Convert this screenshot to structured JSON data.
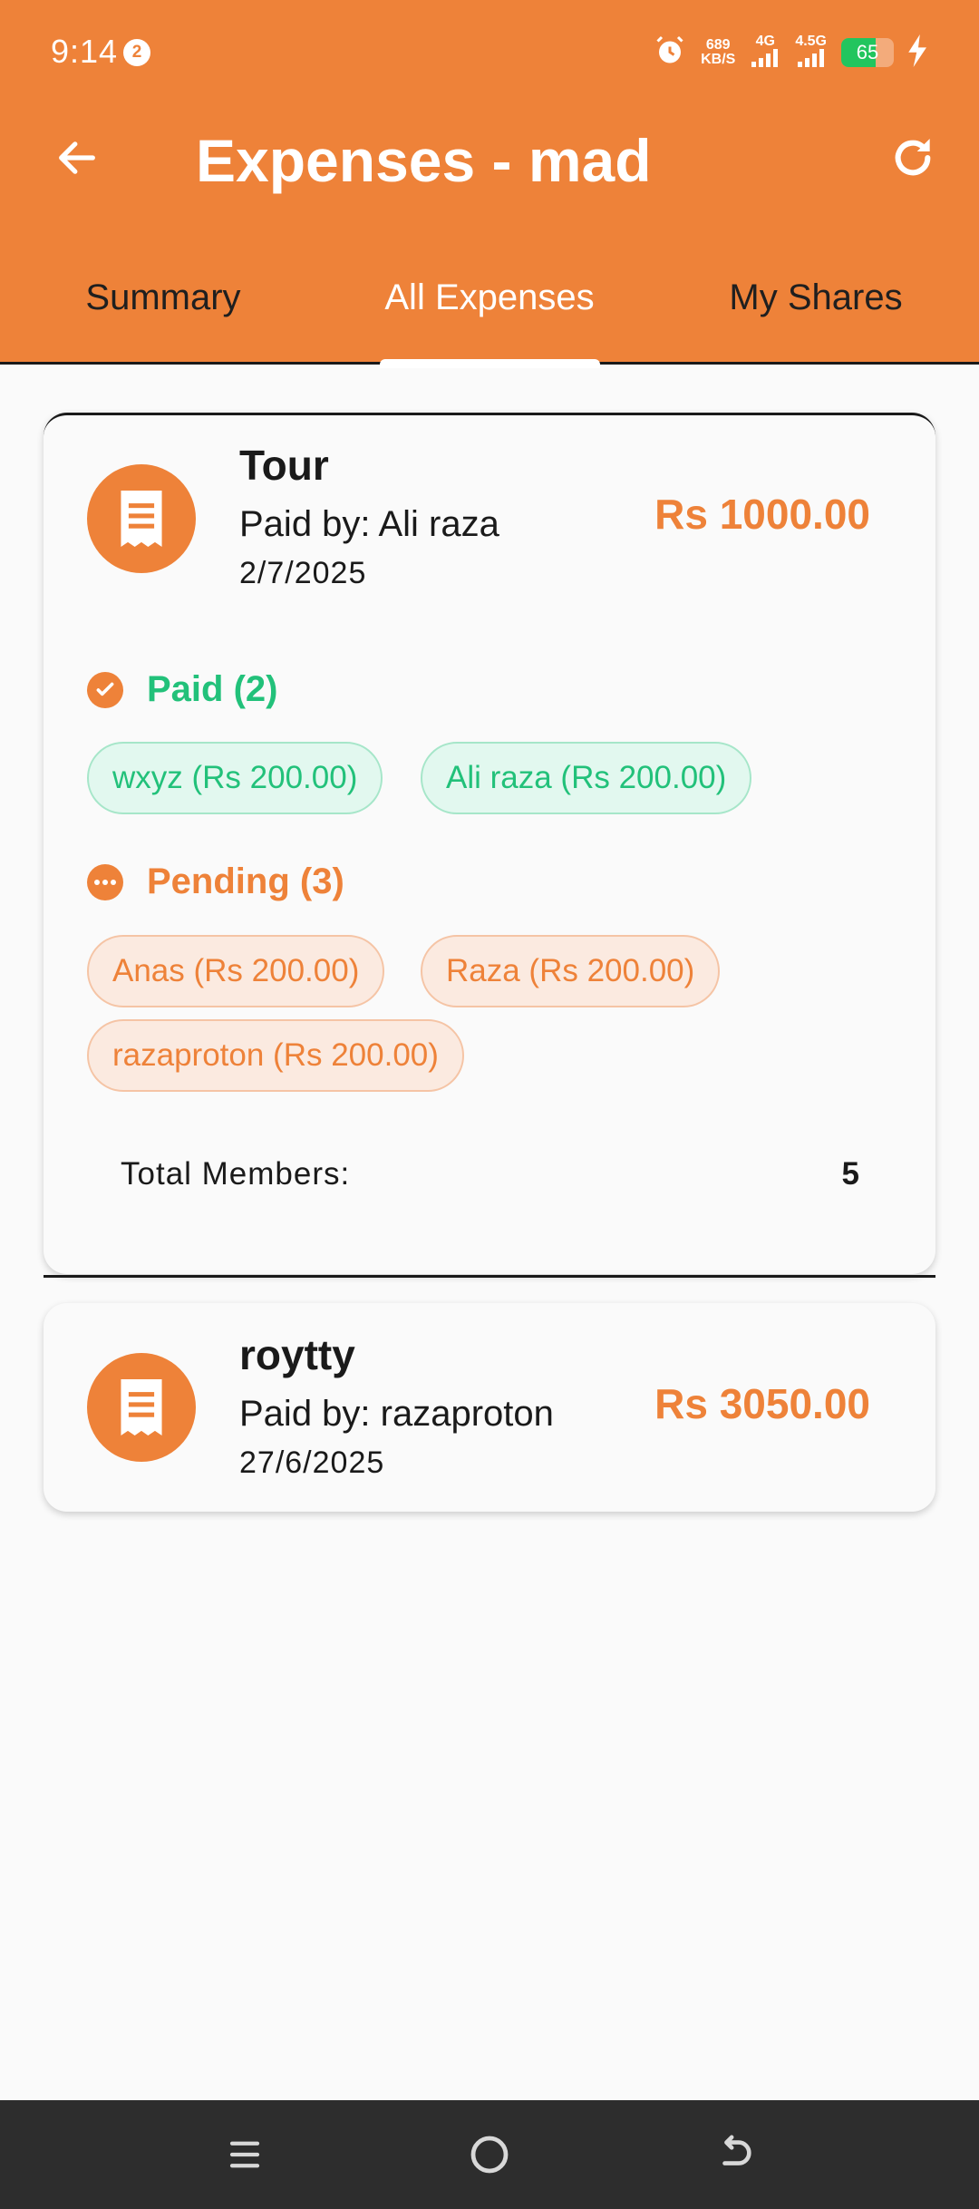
{
  "status_bar": {
    "time": "9:14",
    "notification_count": "2",
    "net_speed_value": "689",
    "net_speed_unit": "KB/S",
    "network_1": "4G",
    "network_2": "4.5G",
    "battery": "65"
  },
  "header": {
    "title": "Expenses - mad",
    "back_icon": "arrow-left-icon",
    "refresh_icon": "refresh-icon"
  },
  "tabs": [
    {
      "label": "Summary",
      "active": false
    },
    {
      "label": "All Expenses",
      "active": true
    },
    {
      "label": "My Shares",
      "active": false
    }
  ],
  "expenses": [
    {
      "title": "Tour",
      "paid_by": "Paid by: Ali raza",
      "date": "2/7/2025",
      "amount": "Rs 1000.00",
      "paid_heading": "Paid (2)",
      "paid_members": [
        "wxyz (Rs 200.00)",
        "Ali raza (Rs 200.00)"
      ],
      "pending_heading": "Pending (3)",
      "pending_members": [
        "Anas (Rs 200.00)",
        "Raza (Rs 200.00)",
        "razaproton (Rs 200.00)"
      ],
      "total_label": "Total Members:",
      "total_value": "5"
    },
    {
      "title": "roytty",
      "paid_by": "Paid by: razaproton",
      "date": "27/6/2025",
      "amount": "Rs 3050.00"
    }
  ],
  "colors": {
    "primary": "#ee8239",
    "paid_green": "#22c17a",
    "navbar": "#2d2d2d"
  }
}
